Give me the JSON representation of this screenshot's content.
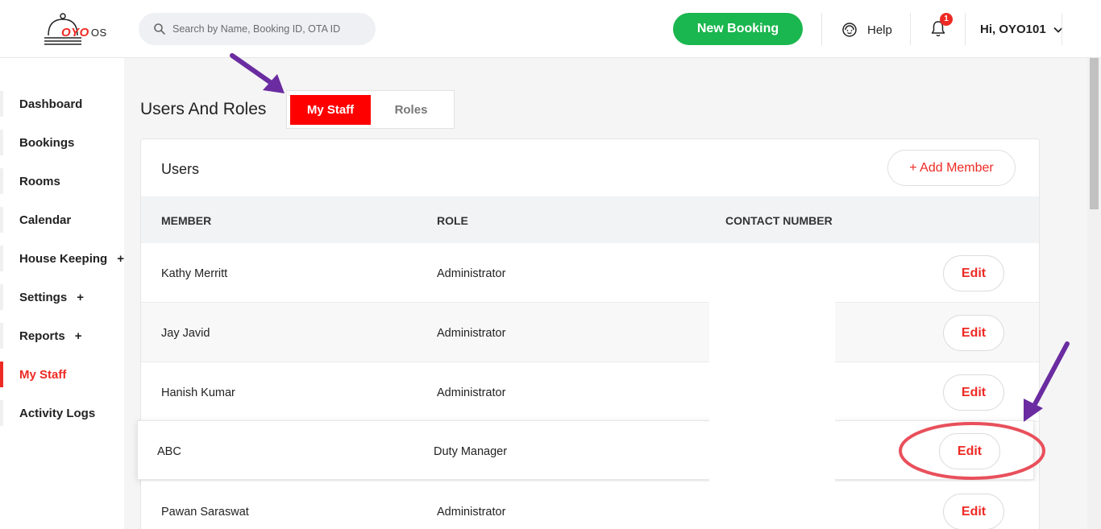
{
  "app": {
    "logo_brand": "OYO",
    "logo_suffix": "OS"
  },
  "topbar": {
    "search_placeholder": "Search by Name, Booking ID, OTA ID",
    "new_booking_label": "New Booking",
    "help_label": "Help",
    "notification_count": "1",
    "user_greeting": "Hi, OYO101"
  },
  "sidebar": {
    "items": [
      {
        "label": "Dashboard",
        "plus": ""
      },
      {
        "label": "Bookings",
        "plus": ""
      },
      {
        "label": "Rooms",
        "plus": ""
      },
      {
        "label": "Calendar",
        "plus": ""
      },
      {
        "label": "House Keeping",
        "plus": "+"
      },
      {
        "label": "Settings",
        "plus": "+"
      },
      {
        "label": "Reports",
        "plus": "+"
      },
      {
        "label": "My Staff",
        "plus": ""
      },
      {
        "label": "Activity Logs",
        "plus": ""
      }
    ]
  },
  "page": {
    "title": "Users And Roles",
    "tabs": [
      "My Staff",
      "Roles"
    ]
  },
  "users_card": {
    "title": "Users",
    "add_member_label": "+  Add Member",
    "columns": [
      "MEMBER",
      "ROLE",
      "CONTACT NUMBER"
    ],
    "rows": [
      {
        "member": "Kathy Merritt",
        "role": "Administrator",
        "contact": "",
        "action": "Edit"
      },
      {
        "member": "Jay Javid",
        "role": "Administrator",
        "contact": "",
        "action": "Edit"
      },
      {
        "member": "Hanish Kumar",
        "role": "Administrator",
        "contact": "",
        "action": "Edit"
      },
      {
        "member": "ABC",
        "role": "Duty Manager",
        "contact": "",
        "action": "Edit"
      },
      {
        "member": "Pawan Saraswat",
        "role": "Administrator",
        "contact": "",
        "action": "Edit"
      }
    ]
  },
  "colors": {
    "brand_red": "#ee2a24",
    "tab_active_red": "#ff0000",
    "new_booking_green": "#1ab64f",
    "annotation_arrow_purple": "#6a2ca0",
    "annotation_circle_red": "#e8505b"
  },
  "icons": {
    "search": "search-icon",
    "help": "headset-icon",
    "notifications": "bell-icon",
    "user_menu": "chevron-down-icon",
    "logo": "cloche-icon"
  }
}
